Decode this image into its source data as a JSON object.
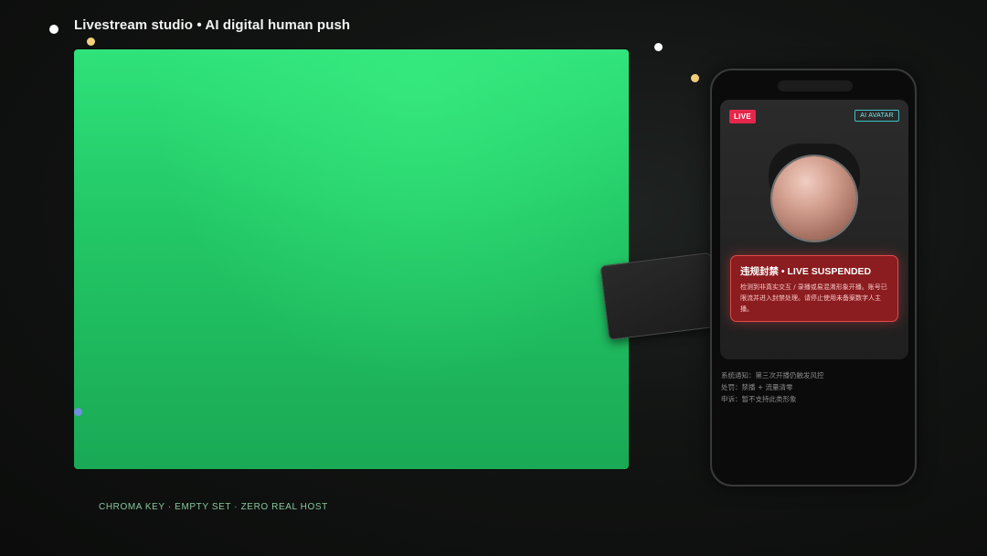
{
  "header": {
    "title": "Livestream studio • AI digital human push"
  },
  "colors": {
    "chroma_green": "#23c866",
    "live_red": "#e6264b",
    "alert_bg": "#8b1c1f",
    "ai_badge_cyan": "#3bc3c9",
    "accent_yellow": "#f3cf7d",
    "accent_blue": "#6f8fe0"
  },
  "stage": {
    "caption": "CHROMA KEY · EMPTY SET · ZERO REAL HOST"
  },
  "phone": {
    "live_badge": "LIVE",
    "ai_badge": "AI AVATAR",
    "alert": {
      "title": "违规封禁 • LIVE SUSPENDED",
      "body": "检测到非真实交互 / 录播或易混淆形象开播。账号已限流并进入封禁处理。请停止使用未备案数字人主播。"
    },
    "notices": [
      "系统通知：第三次开播仍触发风控",
      "处罚：禁播 + 流量清零",
      "申诉：暂不支持此类形象"
    ]
  }
}
